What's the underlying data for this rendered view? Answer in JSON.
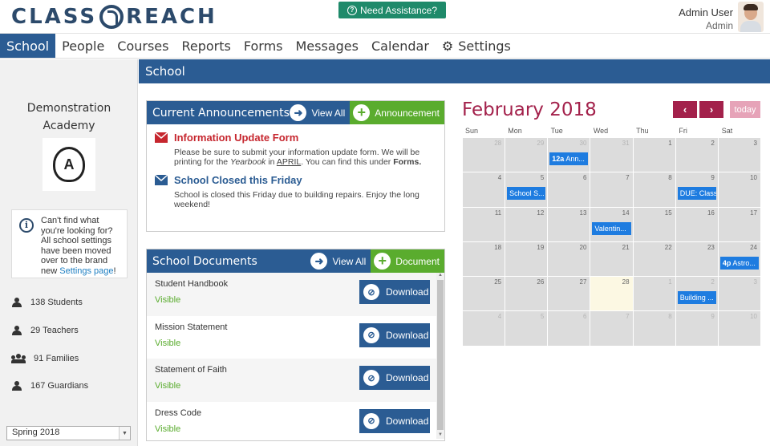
{
  "header": {
    "logo_text_left": "CLASS",
    "logo_text_right": "REACH",
    "assist_label": "Need Assistance?",
    "user_name": "Admin User",
    "user_role": "Admin"
  },
  "nav": {
    "items": [
      {
        "label": "School",
        "active": true
      },
      {
        "label": "People"
      },
      {
        "label": "Courses"
      },
      {
        "label": "Reports"
      },
      {
        "label": "Forms"
      },
      {
        "label": "Messages"
      },
      {
        "label": "Calendar"
      },
      {
        "label": "Settings",
        "icon": "gear-icon"
      }
    ]
  },
  "sidebar": {
    "academy_name_line1": "Demonstration",
    "academy_name_line2": "Academy",
    "logo_letter": "A",
    "info_text": "Can't find what you're looking for? All school settings have been moved over to the brand new ",
    "info_link": "Settings page",
    "info_suffix": "!",
    "stats": [
      {
        "label": "138 Students",
        "icon": "person-icon"
      },
      {
        "label": "29 Teachers",
        "icon": "person-icon"
      },
      {
        "label": "91 Families",
        "icon": "family-icon"
      },
      {
        "label": "167 Guardians",
        "icon": "person-icon"
      }
    ],
    "term": "Spring 2018"
  },
  "main": {
    "title": "School"
  },
  "announcements": {
    "title": "Current Announcements",
    "view_all": "View All",
    "add_label": "Announcement",
    "items": [
      {
        "title": "Information Update Form",
        "body_1": "Please be sure to submit your information update form. We will be printing for the ",
        "body_italic": "Yearbook",
        "body_2": " in ",
        "body_underline": "APRIL",
        "body_3": ". You can find this under ",
        "body_bold": "Forms.",
        "color": "#c6262e"
      },
      {
        "title": "School Closed this Friday",
        "body": "School is closed this Friday due to building repairs. Enjoy the long weekend!",
        "color": "#2b5c93"
      }
    ]
  },
  "documents": {
    "title": "School Documents",
    "view_all": "View All",
    "add_label": "Document",
    "download_label": "Download",
    "items": [
      {
        "name": "Student Handbook",
        "status": "Visible"
      },
      {
        "name": "Mission Statement",
        "status": "Visible"
      },
      {
        "name": "Statement of Faith",
        "status": "Visible"
      },
      {
        "name": "Dress Code",
        "status": "Visible"
      }
    ]
  },
  "calendar": {
    "title": "February 2018",
    "today_label": "today",
    "prev_icon": "chevron-left-icon",
    "next_icon": "chevron-right-icon",
    "dow": [
      "Sun",
      "Mon",
      "Tue",
      "Wed",
      "Thu",
      "Fri",
      "Sat"
    ],
    "weeks": [
      [
        "28",
        "29",
        "30",
        "31",
        "1",
        "2",
        "3"
      ],
      [
        "4",
        "5",
        "6",
        "7",
        "8",
        "9",
        "10"
      ],
      [
        "11",
        "12",
        "13",
        "14",
        "15",
        "16",
        "17"
      ],
      [
        "18",
        "19",
        "20",
        "21",
        "22",
        "23",
        "24"
      ],
      [
        "25",
        "26",
        "27",
        "28",
        "1",
        "2",
        "3"
      ],
      [
        "4",
        "5",
        "6",
        "7",
        "8",
        "9",
        "10"
      ]
    ],
    "events": {
      "e1_time": "12a",
      "e1_text": " Ann...",
      "e2_text": "School S...",
      "e3_text": "DUE: Class",
      "e4_text": "Valentin...",
      "e5_time": "4p",
      "e5_text": " Astro...",
      "e6_text": "Building ..."
    },
    "accent_color": "#a3214b",
    "event_color": "#1e7ce0"
  }
}
